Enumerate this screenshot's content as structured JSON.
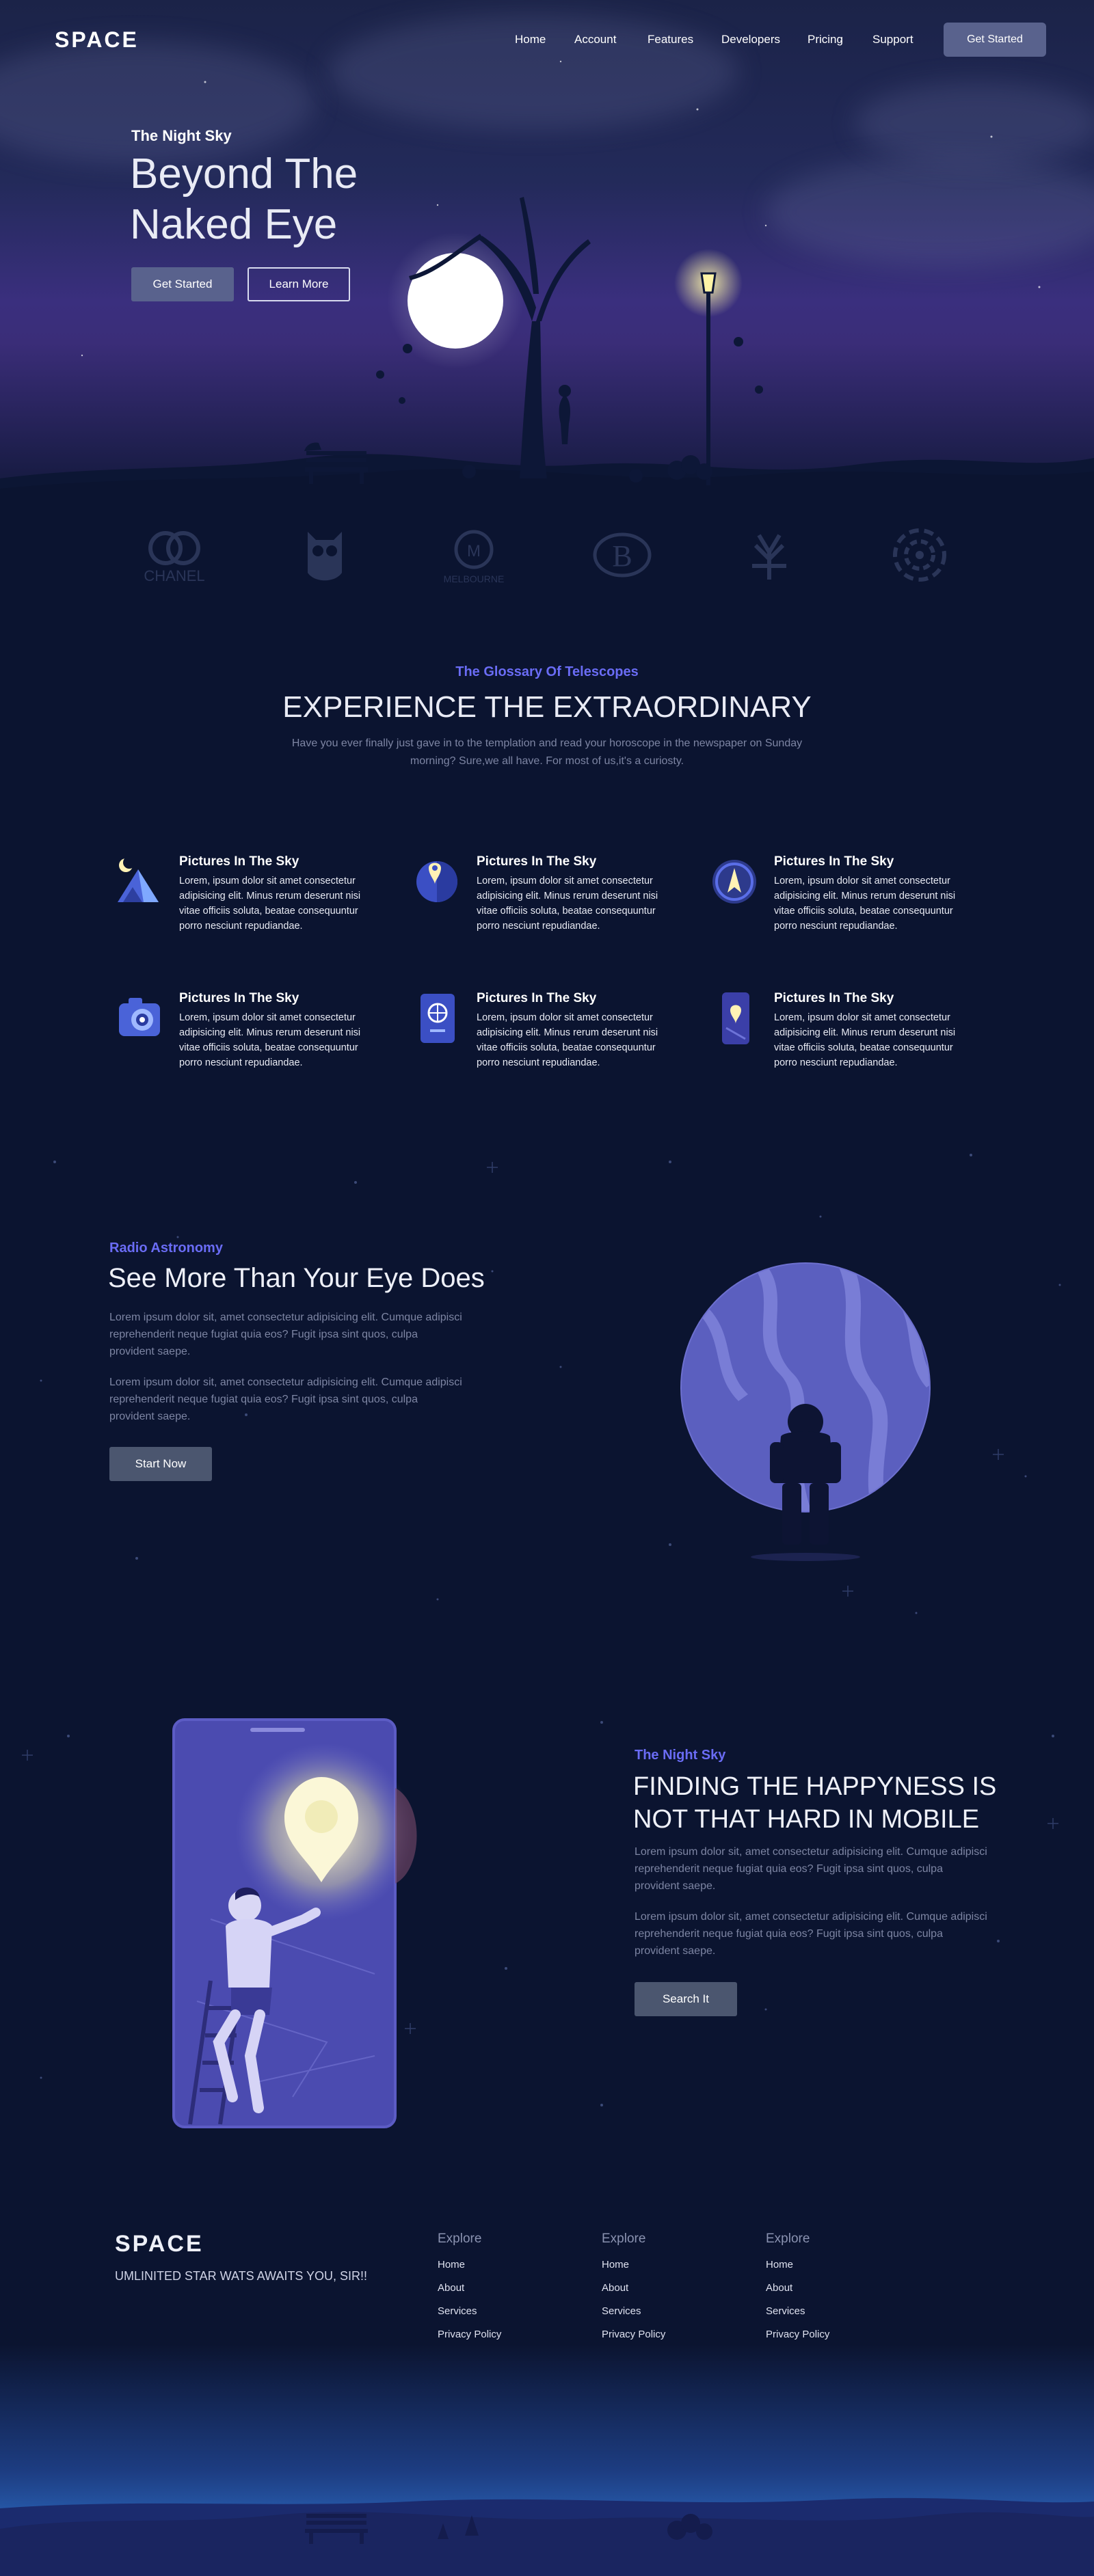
{
  "nav": {
    "logo": "SPACE",
    "links": [
      "Home",
      "Account",
      "Features",
      "Developers",
      "Pricing",
      "Support"
    ],
    "cta": "Get Started"
  },
  "hero": {
    "eyebrow": "The Night Sky",
    "title": "Beyond The Naked Eye",
    "primary_button": "Get Started",
    "secondary_button": "Learn More"
  },
  "brands": {
    "names": [
      "CHANEL",
      "owl",
      "MELBOURNE",
      "B",
      "tree",
      "spiral"
    ]
  },
  "glossary": {
    "eyebrow": "The Glossary Of Telescopes",
    "title": "EXPERIENCE THE EXTRAORDINARY",
    "description": "Have you ever finally just gave in to the templation and read your horoscope in the newspaper on Sunday morning? Sure,we all have. For most of us,it's a curiosty.",
    "features": [
      {
        "icon": "mountain-moon-icon",
        "title": "Pictures In The Sky",
        "text": "Lorem, ipsum dolor sit amet consectetur adipisicing elit. Minus rerum deserunt nisi vitae officiis soluta, beatae consequuntur porro nesciunt repudiandae."
      },
      {
        "icon": "map-pin-icon",
        "title": "Pictures In The Sky",
        "text": "Lorem, ipsum dolor sit amet consectetur adipisicing elit. Minus rerum deserunt nisi vitae officiis soluta, beatae consequuntur porro nesciunt repudiandae."
      },
      {
        "icon": "compass-icon",
        "title": "Pictures In The Sky",
        "text": "Lorem, ipsum dolor sit amet consectetur adipisicing elit. Minus rerum deserunt nisi vitae officiis soluta, beatae consequuntur porro nesciunt repudiandae."
      },
      {
        "icon": "camera-icon",
        "title": "Pictures In The Sky",
        "text": "Lorem, ipsum dolor sit amet consectetur adipisicing elit. Minus rerum deserunt nisi vitae officiis soluta, beatae consequuntur porro nesciunt repudiandae."
      },
      {
        "icon": "passport-icon",
        "title": "Pictures In The Sky",
        "text": "Lorem, ipsum dolor sit amet consectetur adipisicing elit. Minus rerum deserunt nisi vitae officiis soluta, beatae consequuntur porro nesciunt repudiandae."
      },
      {
        "icon": "phone-map-icon",
        "title": "Pictures In The Sky",
        "text": "Lorem, ipsum dolor sit amet consectetur adipisicing elit. Minus rerum deserunt nisi vitae officiis soluta, beatae consequuntur porro nesciunt repudiandae."
      }
    ]
  },
  "radio": {
    "eyebrow": "Radio Astronomy",
    "title": "See More Than Your Eye Does",
    "paragraphs": [
      "Lorem ipsum dolor sit, amet consectetur adipisicing elit. Cumque adipisci reprehenderit neque fugiat quia eos? Fugit ipsa sint quos, culpa provident saepe.",
      "Lorem ipsum dolor sit, amet consectetur adipisicing elit. Cumque adipisci reprehenderit neque fugiat quia eos? Fugit ipsa sint quos, culpa provident saepe."
    ],
    "button": "Start Now"
  },
  "mobile": {
    "eyebrow": "The Night Sky",
    "title": "FINDING THE HAPPYNESS IS NOT THAT HARD IN MOBILE",
    "paragraphs": [
      "Lorem ipsum dolor sit, amet consectetur adipisicing elit. Cumque adipisci reprehenderit neque fugiat quia eos? Fugit ipsa sint quos, culpa provident saepe.",
      "Lorem ipsum dolor sit, amet consectetur adipisicing elit. Cumque adipisci reprehenderit neque fugiat quia eos? Fugit ipsa sint quos, culpa provident saepe."
    ],
    "button": "Search It"
  },
  "footer": {
    "logo": "SPACE",
    "tagline": "UMLINITED STAR WATS AWAITS YOU, SIR!!",
    "columns": [
      {
        "heading": "Explore",
        "links": [
          "Home",
          "About",
          "Services",
          "Privacy Policy"
        ]
      },
      {
        "heading": "Explore",
        "links": [
          "Home",
          "About",
          "Services",
          "Privacy Policy"
        ]
      },
      {
        "heading": "Explore",
        "links": [
          "Home",
          "About",
          "Services",
          "Privacy Policy"
        ]
      }
    ]
  },
  "colors": {
    "accent": "#6a6cf5",
    "background": "#0b1430",
    "button": "#59628d",
    "muted_text": "#7d85a3"
  }
}
